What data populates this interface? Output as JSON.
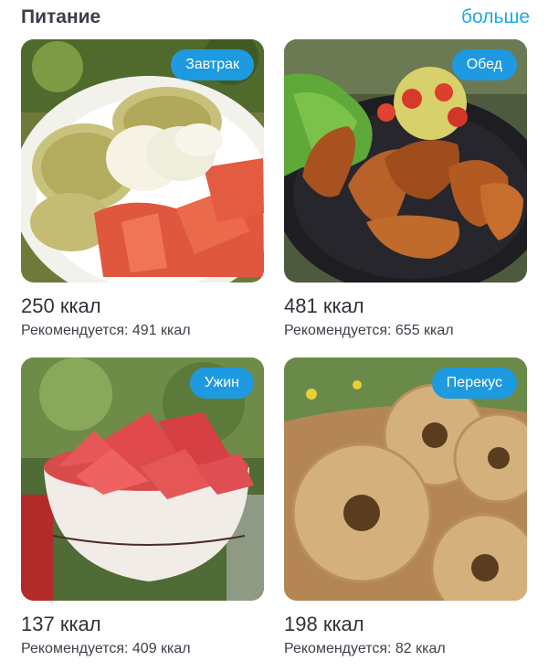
{
  "header": {
    "title": "Питание",
    "more_label": "больше"
  },
  "meals": [
    {
      "tag": "Завтрак",
      "kcal": "250 ккал",
      "recommended": "Рекомендуется: 491 ккал",
      "image": "breakfast-photo"
    },
    {
      "tag": "Обед",
      "kcal": "481 ккал",
      "recommended": "Рекомендуется: 655 ккал",
      "image": "lunch-photo"
    },
    {
      "tag": "Ужин",
      "kcal": "137 ккал",
      "recommended": "Рекомендуется: 409 ккал",
      "image": "dinner-photo"
    },
    {
      "tag": "Перекус",
      "kcal": "198 ккал",
      "recommended": "Рекомендуется: 82 ккал",
      "image": "snack-photo"
    }
  ],
  "colors": {
    "accent": "#1e9ae0",
    "link": "#21a8e6",
    "text": "#2e333a"
  }
}
